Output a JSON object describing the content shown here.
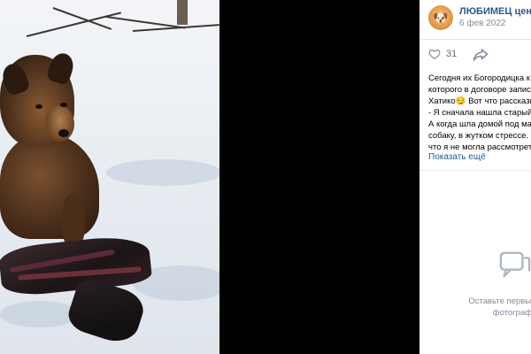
{
  "post": {
    "group_name": "ЛЮБИМЕЦ центр п",
    "date": "6 фев 2022",
    "likes": "31",
    "text_lines": [
      "Сегодня их Богородицка к н",
      "которого в договоре записа",
      "Хатико😏 Вот что рассказы",
      "- Я сначала нашла старый р",
      "А когда шла домой под ма",
      "собаку, в жутком стрессе. С",
      "что я не могла рассмотреть"
    ],
    "show_more": "Показать ещё"
  },
  "comments": {
    "empty_line1": "Оставьте первый комм",
    "empty_line2": "фотографі"
  },
  "icons": {
    "like": "heart-icon",
    "share": "share-arrow-icon",
    "comments": "speech-bubble-icon",
    "avatar": "group-avatar"
  },
  "colors": {
    "link": "#2a5885",
    "muted": "#818c99",
    "background": "#000000",
    "panel": "#ffffff"
  }
}
